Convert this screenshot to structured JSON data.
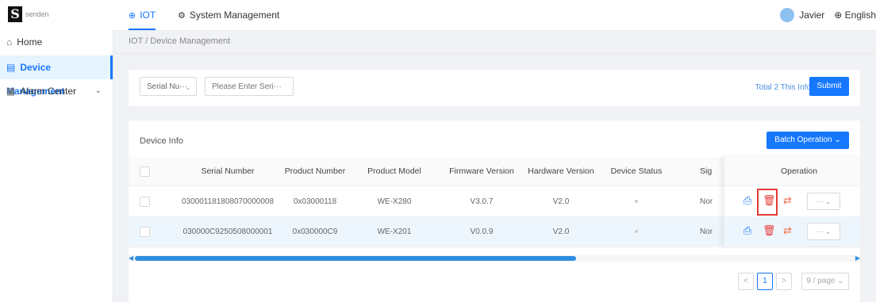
{
  "brand": {
    "logo_letter": "S",
    "name": "senden"
  },
  "topnav": {
    "tabs": [
      {
        "label": "IOT",
        "icon": "globe-icon",
        "active": true
      },
      {
        "label": "System Management",
        "icon": "gear-icon",
        "active": false
      }
    ],
    "user": "Javier",
    "language": "English"
  },
  "sidebar": {
    "items": [
      {
        "label": "Home",
        "icon": "home-icon"
      },
      {
        "label": "Device Management",
        "icon": "document-icon",
        "active": true
      },
      {
        "label": "Alarm Center",
        "icon": "calendar-icon",
        "expandable": true
      }
    ]
  },
  "breadcrumb": "IOT / Device Management",
  "filter": {
    "select_value": "Serial Nu···",
    "input_placeholder": "Please Enter Seri···",
    "total_text": "Total 2 This Info",
    "submit_label": "Submit"
  },
  "table": {
    "title": "Device Info",
    "batch_label": "Batch Operation",
    "columns": [
      "Serial Number",
      "Product Number",
      "Product Model",
      "Firmware Version",
      "Hardware Version",
      "Device Status",
      "Sig",
      "Operation"
    ],
    "rows": [
      {
        "serial": "030001181808070000008",
        "product_number": "0x03000118",
        "model": "WE-X280",
        "firmware": "V3.0.7",
        "hardware": "V2.0",
        "signal": "Nor",
        "more": "···"
      },
      {
        "serial": "030000C9250508000001",
        "product_number": "0x030000C9",
        "model": "WE-X201",
        "firmware": "V0.0.9",
        "hardware": "V2.0",
        "signal": "Nor",
        "more": "···"
      }
    ],
    "scroll_position": 0.6
  },
  "pagination": {
    "prev": "<",
    "page": "1",
    "next": ">",
    "page_size": "9 / page"
  },
  "colors": {
    "accent": "#1677ff",
    "danger": "#e53935"
  }
}
